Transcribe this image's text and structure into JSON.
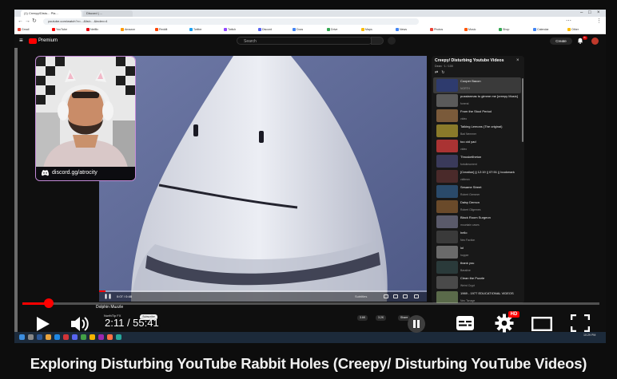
{
  "browser": {
    "tabs": [
      {
        "label": "(1) Creepy/Distu... Pla..."
      },
      {
        "label": "Discord | ..."
      }
    ],
    "url": "youtube.com/watch?v=...&list=...&index=4",
    "bookmarks": [
      "Gmail",
      "YouTube",
      "Netflix",
      "Amazon",
      "Reddit",
      "Twitter",
      "Twitch",
      "Discord",
      "Docs",
      "Drive",
      "Maps",
      "News",
      "Photos",
      "Music",
      "Shop",
      "Calendar",
      "Other"
    ]
  },
  "youtube": {
    "logo_text": "Premium",
    "search_placeholder": "Search",
    "create_label": "Create",
    "notif_badge": "9+"
  },
  "webcam": {
    "link": "discord.gg/atrocity"
  },
  "inner_player": {
    "time": "0:07 / 0:48",
    "label": "Subtitles"
  },
  "playlist": {
    "title": "Creepy/ Disturbing Youtube Videos",
    "meta": "Dean · 1 / 100",
    "items": [
      {
        "title": "Cooper Bacon",
        "channel": "NORTH",
        "color": "#2e3b6e"
      },
      {
        "title": "pusstarmas to gimme me [creepy Music]",
        "channel": "funeral",
        "color": "#5a5a5a"
      },
      {
        "title": "From the Stool Period",
        "channel": "video",
        "color": "#7a5a3a"
      },
      {
        "title": "Talking Lemons (The original)",
        "channel": "Bad Nemmer",
        "color": "#8a7a2a"
      },
      {
        "title": "too oid yad",
        "channel": "video",
        "color": "#a33"
      },
      {
        "title": "Thruskeliheton",
        "channel": "fortuitmoment",
        "color": "#3a3a5a"
      },
      {
        "title": "[Creation] || 12:19 || 07:51 || bookmark",
        "channel": "vidbrwn",
        "color": "#4a2a2a"
      },
      {
        "title": "Sesame Street",
        "channel": "Robert Gemmer",
        "color": "#2a4a6a"
      },
      {
        "title": "Daisy Demon",
        "channel": "Robert Gilgemes",
        "color": "#6a4a2a"
      },
      {
        "title": "Black Room Surgeon",
        "channel": "mountain caves",
        "color": "#5a5a6a"
      },
      {
        "title": "hello",
        "channel": "Neo Faction",
        "color": "#3a3a3a"
      },
      {
        "title": "lol",
        "channel": "hopper",
        "color": "#6a6a6a"
      },
      {
        "title": "thank you",
        "channel": "Bassline",
        "color": "#2a3a3a"
      },
      {
        "title": "Clean the Puzzle",
        "channel": "Weird Crypt",
        "color": "#4a4a4a"
      },
      {
        "title": "1969 - 1977 EDUCATIONAL VIDEOS",
        "channel": "Neo Tanage",
        "color": "#5a6a4a"
      }
    ]
  },
  "now_playing": {
    "title": "Dolphin Muzzle",
    "channel": "NorthTip FX",
    "subscribe": "Subscribe",
    "like": "3.6K",
    "dislike": "3.2K",
    "share": "Share"
  },
  "outer_player": {
    "time": "2:11 / 55:41",
    "progress_fraction": 0.04,
    "hd_badge": "HD"
  },
  "taskbar": {
    "clock": "10:29 PM"
  },
  "video_title": "Exploring Disturbing YouTube Rabbit Holes (Creepy/ Disturbing YouTube Videos)",
  "colors": {
    "accent": "#ff0000",
    "background": "#0d0d0d",
    "webcam_border": "#c48ad8"
  }
}
